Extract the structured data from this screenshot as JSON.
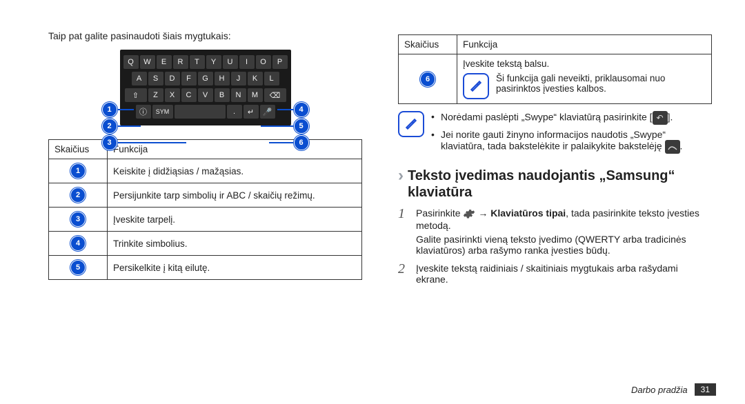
{
  "left": {
    "intro": "Taip pat galite pasinaudoti šiais mygtukais:",
    "keyboard_rows": [
      [
        "Q",
        "W",
        "E",
        "R",
        "T",
        "Y",
        "U",
        "I",
        "O",
        "P"
      ],
      [
        "A",
        "S",
        "D",
        "F",
        "G",
        "H",
        "J",
        "K",
        "L"
      ],
      [
        "⇧",
        "Z",
        "X",
        "C",
        "V",
        "B",
        "N",
        "M",
        "⌫"
      ],
      [
        "ⓘ",
        "SYM",
        "",
        "",
        "↩",
        "🎤"
      ]
    ],
    "table": {
      "headers": {
        "num": "Skaičius",
        "func": "Funkcija"
      },
      "rows": [
        {
          "n": "1",
          "t": "Keiskite į didžiąsias / mažąsias."
        },
        {
          "n": "2",
          "t": "Persijunkite tarp simbolių ir ABC / skaičių režimų."
        },
        {
          "n": "3",
          "t": "Įveskite tarpelį."
        },
        {
          "n": "4",
          "t": "Trinkite simbolius."
        },
        {
          "n": "5",
          "t": "Persikelkite į kitą eilutę."
        }
      ]
    }
  },
  "right": {
    "table": {
      "headers": {
        "num": "Skaičius",
        "func": "Funkcija"
      },
      "row6": {
        "n": "6",
        "line1": "Įveskite tekstą balsu.",
        "note": "Ši funkcija gali neveikti, priklausomai nuo pasirinktos įvesties kalbos."
      }
    },
    "notes": {
      "b1_pre": "Norėdami paslėpti „Swype“ klaviatūrą pasirinkite [",
      "b1_post": "].",
      "b2_pre": "Jei norite gauti žinyno informacijos naudotis „Swype“ klaviatūra, tada bakstelėkite ir palaikykite bakstelėję ",
      "b2_post": "."
    },
    "heading": "Teksto įvedimas naudojantis „Samsung“ klaviatūra",
    "step1": {
      "pre": "Pasirinkite ",
      "mid": " → ",
      "bold": "Klaviatūros tipai",
      "post": ", tada pasirinkite teksto įvesties metodą.",
      "sub": "Galite pasirinkti vieną teksto įvedimo (QWERTY arba tradicinės klaviatūros) arba rašymo ranka įvesties būdų."
    },
    "step2": "Įveskite tekstą raidiniais / skaitiniais mygtukais arba rašydami ekrane."
  },
  "footer": {
    "section": "Darbo pradžia",
    "page": "31"
  }
}
